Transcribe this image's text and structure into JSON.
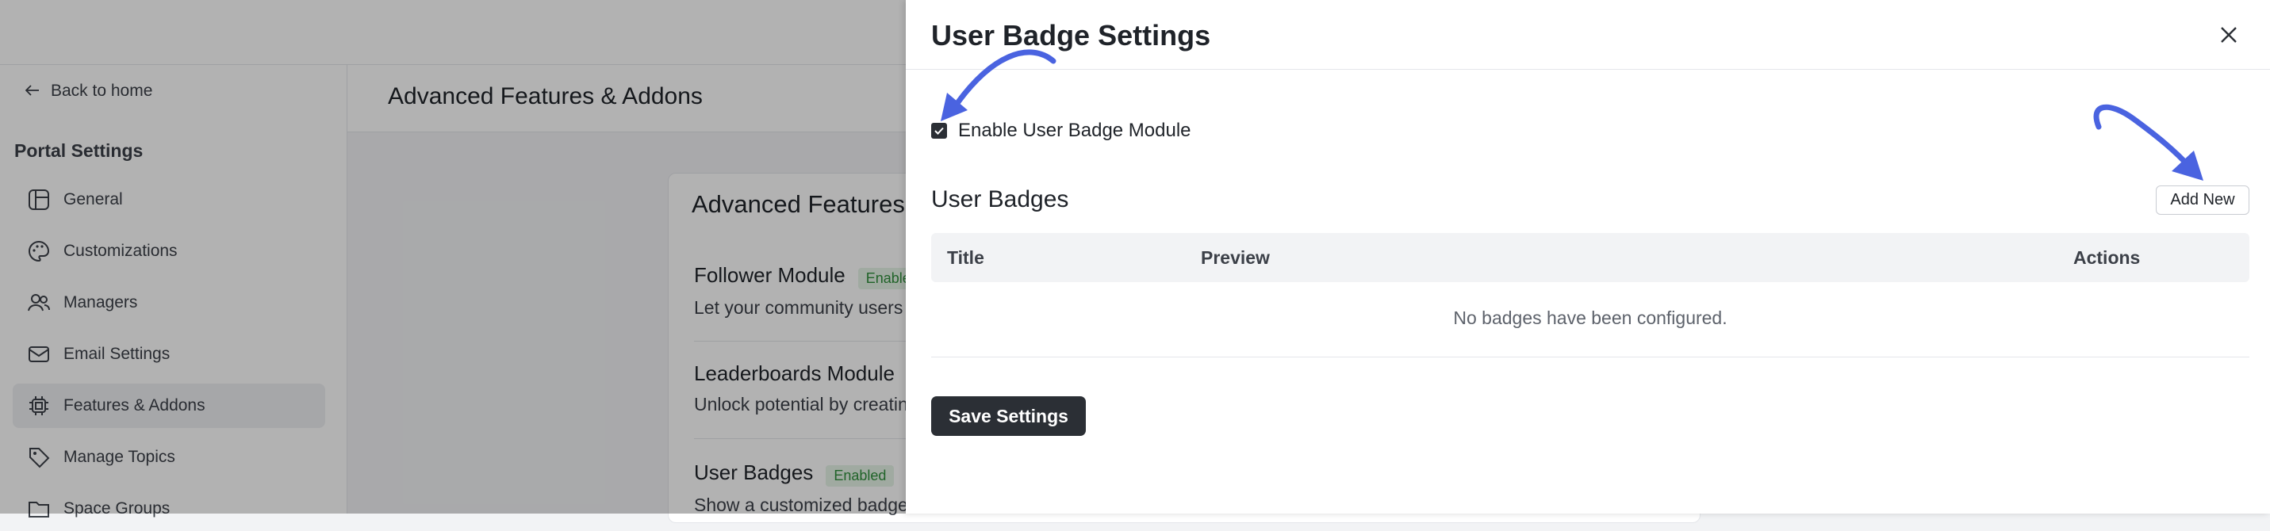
{
  "sidebar": {
    "back_label": "Back to home",
    "section_title": "Portal Settings",
    "items": [
      {
        "label": "General",
        "icon": "layout-icon"
      },
      {
        "label": "Customizations",
        "icon": "palette-icon"
      },
      {
        "label": "Managers",
        "icon": "users-icon"
      },
      {
        "label": "Email Settings",
        "icon": "mail-icon"
      },
      {
        "label": "Features & Addons",
        "icon": "cpu-icon",
        "active": true
      },
      {
        "label": "Manage Topics",
        "icon": "tag-icon"
      },
      {
        "label": "Space Groups",
        "icon": "folder-icon"
      }
    ]
  },
  "main": {
    "title": "Advanced Features & Addons",
    "card_title": "Advanced Features",
    "features": [
      {
        "name": "Follower Module",
        "status": "Enabled",
        "description": "Let your community users"
      },
      {
        "name": "Leaderboards Module",
        "status": "",
        "description": "Unlock potential by creatin"
      },
      {
        "name": "User Badges",
        "status": "Enabled",
        "description": "Show a customized badge"
      }
    ]
  },
  "drawer": {
    "title": "User Badge Settings",
    "enable_label": "Enable User Badge Module",
    "enable_checked": true,
    "section_title": "User Badges",
    "add_button": "Add New",
    "columns": [
      "Title",
      "Preview",
      "Actions"
    ],
    "empty_text": "No badges have been configured.",
    "save_button": "Save Settings"
  },
  "colors": {
    "primary_button": "#2b2f35",
    "annotation_arrow": "#4a63e0",
    "enabled_badge": "#2f8f3b"
  }
}
